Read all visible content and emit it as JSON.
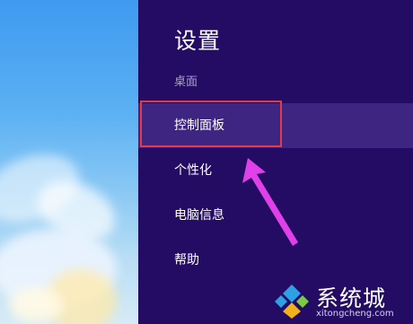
{
  "settings_panel": {
    "title": "设置",
    "subtitle": "桌面",
    "items": [
      {
        "label": "控制面板",
        "selected": true
      },
      {
        "label": "个性化",
        "selected": false
      },
      {
        "label": "电脑信息",
        "selected": false
      },
      {
        "label": "帮助",
        "selected": false
      }
    ]
  },
  "annotation": {
    "highlight_color": "#e23a4a",
    "arrow_color": "#e040e8"
  },
  "watermark": {
    "name": "系统城",
    "url": "xitongcheng.com"
  },
  "colors": {
    "panel_background": "#240c64",
    "selected_item": "#3d2581",
    "subtitle_text": "#a89fcc"
  }
}
